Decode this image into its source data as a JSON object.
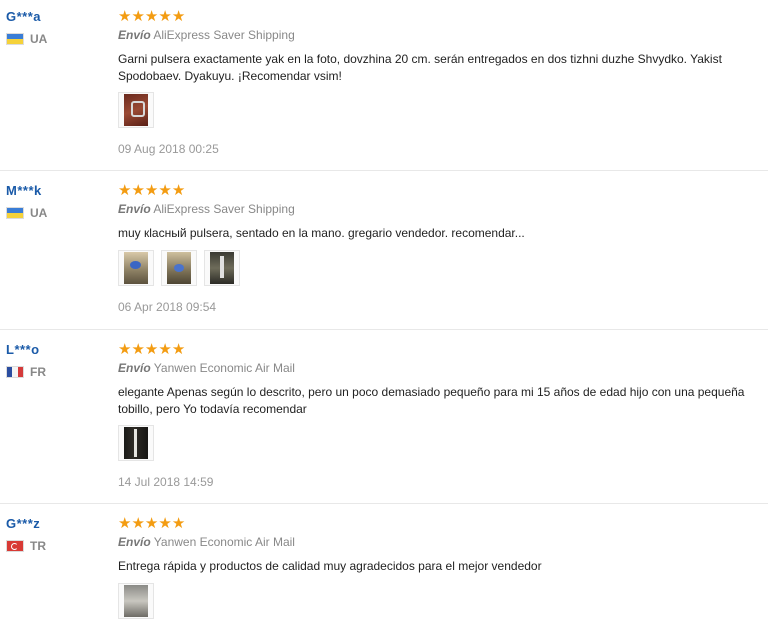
{
  "reviews": [
    {
      "user": "G***a",
      "country": "UA",
      "rating": 5,
      "shipping_label": "Envío",
      "shipping_method": "AliExpress Saver Shipping",
      "text": "Garni pulsera exactamente yak en la foto, dovzhina 20 cm. serán entregados en dos tizhni duzhe Shvydko. Yakist Spodobaev. Dyakuyu. ¡Recomendar vsim!",
      "photos": 1,
      "date": "09 Aug 2018 00:25"
    },
    {
      "user": "M***k",
      "country": "UA",
      "rating": 5,
      "shipping_label": "Envío",
      "shipping_method": "AliExpress Saver Shipping",
      "text": "muy кlасный pulsera, sentado en la mano. gregario vendedor. recomendar...",
      "photos": 3,
      "date": "06 Apr 2018 09:54"
    },
    {
      "user": "L***o",
      "country": "FR",
      "rating": 5,
      "shipping_label": "Envío",
      "shipping_method": "Yanwen Economic Air Mail",
      "text": "elegante Apenas según lo descrito, pero un poco demasiado pequeño para mi 15 años de edad hijo con una pequeña tobillo, pero Yo todavía recomendar",
      "photos": 1,
      "date": "14 Jul 2018 14:59"
    },
    {
      "user": "G***z",
      "country": "TR",
      "rating": 5,
      "shipping_label": "Envío",
      "shipping_method": "Yanwen Economic Air Mail",
      "text": "Entrega rápida y productos de calidad muy agradecidos para el mejor vendedor",
      "photos": 1,
      "date": ""
    }
  ]
}
